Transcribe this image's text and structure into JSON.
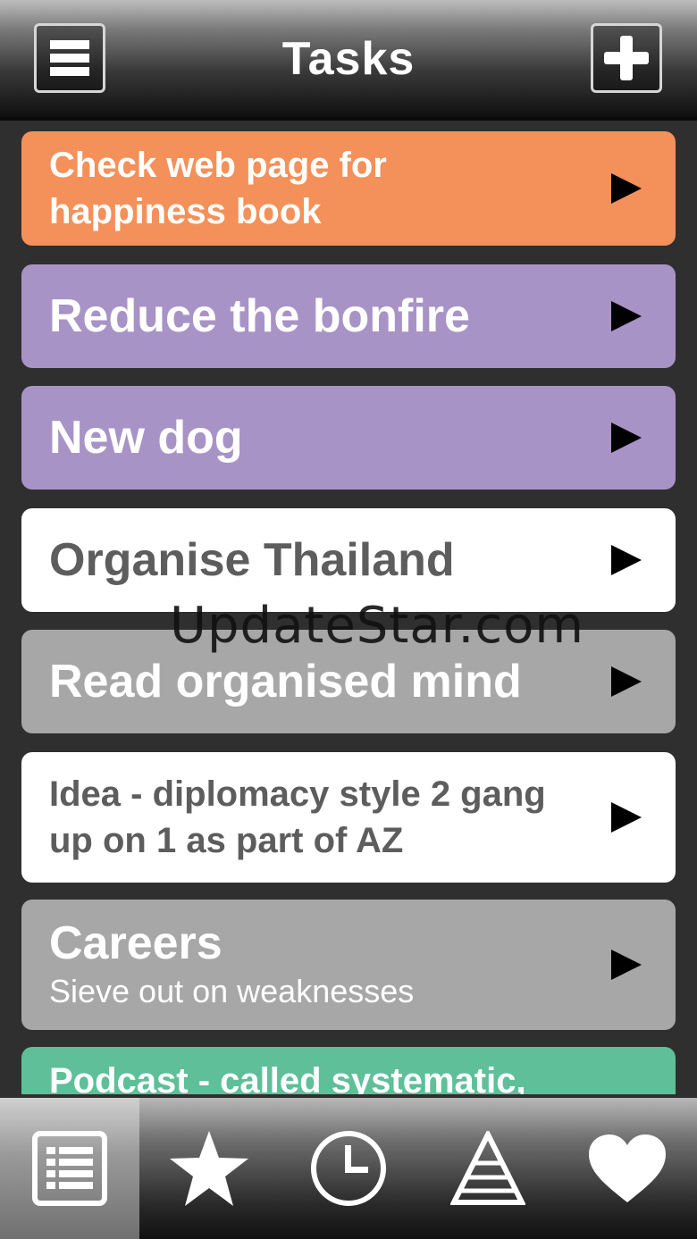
{
  "header": {
    "title": "Tasks"
  },
  "icons": {
    "menu": "menu-icon",
    "add": "plus-icon",
    "arrow": "play-arrow-icon"
  },
  "tasks": [
    {
      "title": "Check web page for happiness book",
      "color": "#f4905a",
      "text_color": "#ffffff"
    },
    {
      "title": "Reduce the bonfire",
      "color": "#a893c6",
      "text_color": "#ffffff"
    },
    {
      "title": "New dog",
      "color": "#a893c6",
      "text_color": "#ffffff"
    },
    {
      "title": "Organise Thailand",
      "color": "#ffffff",
      "text_color": "#5d5d5d"
    },
    {
      "title": "Read organised mind",
      "color": "#a7a7a7",
      "text_color": "#ffffff"
    },
    {
      "title": "Idea - diplomacy style 2 gang up on 1 as part of AZ",
      "color": "#ffffff",
      "text_color": "#5d5d5d"
    },
    {
      "title": "Careers",
      "subtitle": "Sieve out on weaknesses",
      "color": "#a7a7a7",
      "text_color": "#ffffff"
    },
    {
      "title": "Podcast - called systematic,",
      "color": "#5ebf99",
      "text_color": "#ffffff"
    }
  ],
  "watermark": "UpdateStar.com",
  "tabs": [
    {
      "icon": "list-icon",
      "active": true
    },
    {
      "icon": "star-icon",
      "active": false
    },
    {
      "icon": "clock-icon",
      "active": false
    },
    {
      "icon": "pyramid-icon",
      "active": false
    },
    {
      "icon": "heart-icon",
      "active": false
    }
  ]
}
